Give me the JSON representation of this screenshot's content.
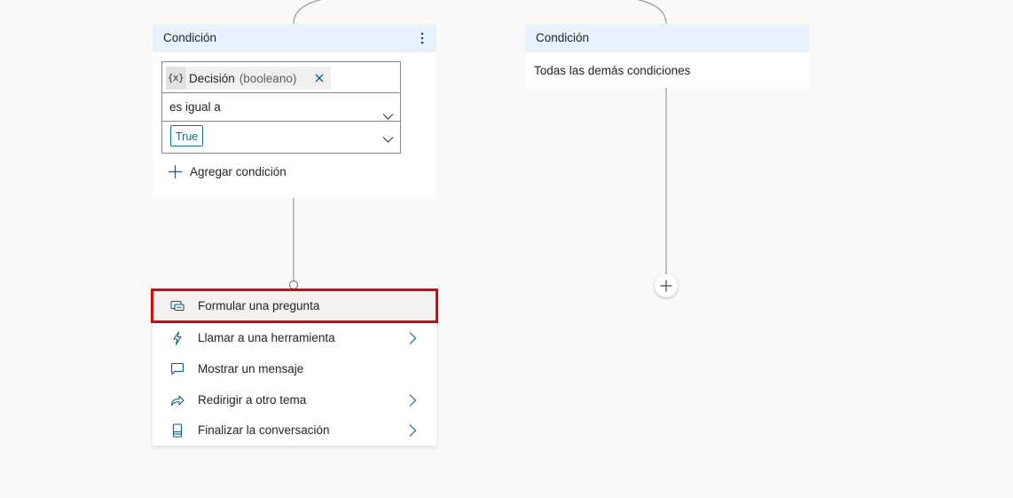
{
  "condition_card": {
    "header": "Condición",
    "variable_icon": "{x}",
    "variable_name": "Decisión",
    "variable_type": "(booleano)",
    "operator": "es igual a",
    "value": "True",
    "add_condition": "Agregar condición"
  },
  "else_card": {
    "header": "Condición",
    "body": "Todas las demás condiciones"
  },
  "menu": {
    "items": [
      {
        "label": "Formular una pregunta",
        "icon": "ask-question-icon",
        "submenu": false,
        "selected": true
      },
      {
        "label": "Llamar a una herramienta",
        "icon": "lightning-icon",
        "submenu": true,
        "selected": false
      },
      {
        "label": "Mostrar un mensaje",
        "icon": "message-icon",
        "submenu": false,
        "selected": false
      },
      {
        "label": "Redirigir a otro tema",
        "icon": "redirect-arrow-icon",
        "submenu": true,
        "selected": false
      },
      {
        "label": "Finalizar la conversación",
        "icon": "end-conversation-icon",
        "submenu": true,
        "selected": false
      }
    ]
  },
  "colors": {
    "canvas": "#faf9f8",
    "header": "#e8f2fd",
    "highlight": "#e3000b",
    "accent": "#0f6cbd"
  }
}
